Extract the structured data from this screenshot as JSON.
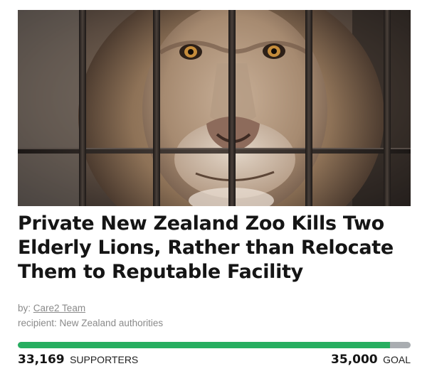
{
  "petition": {
    "image_alt": "Lion behind cage bars",
    "title": "Private New Zealand Zoo Kills Two Elderly Lions, Rather than Relocate Them to Reputable Facility",
    "by_prefix": "by:",
    "author": "Care2 Team",
    "recipient_label": "recipient: New Zealand authorities"
  },
  "progress": {
    "supporters_count": "33,169",
    "supporters_label": "SUPPORTERS",
    "goal_count": "35,000",
    "goal_label": "GOAL",
    "fraction": 0.9477,
    "fill_color": "#27ae60",
    "track_color": "#a9adb1"
  }
}
